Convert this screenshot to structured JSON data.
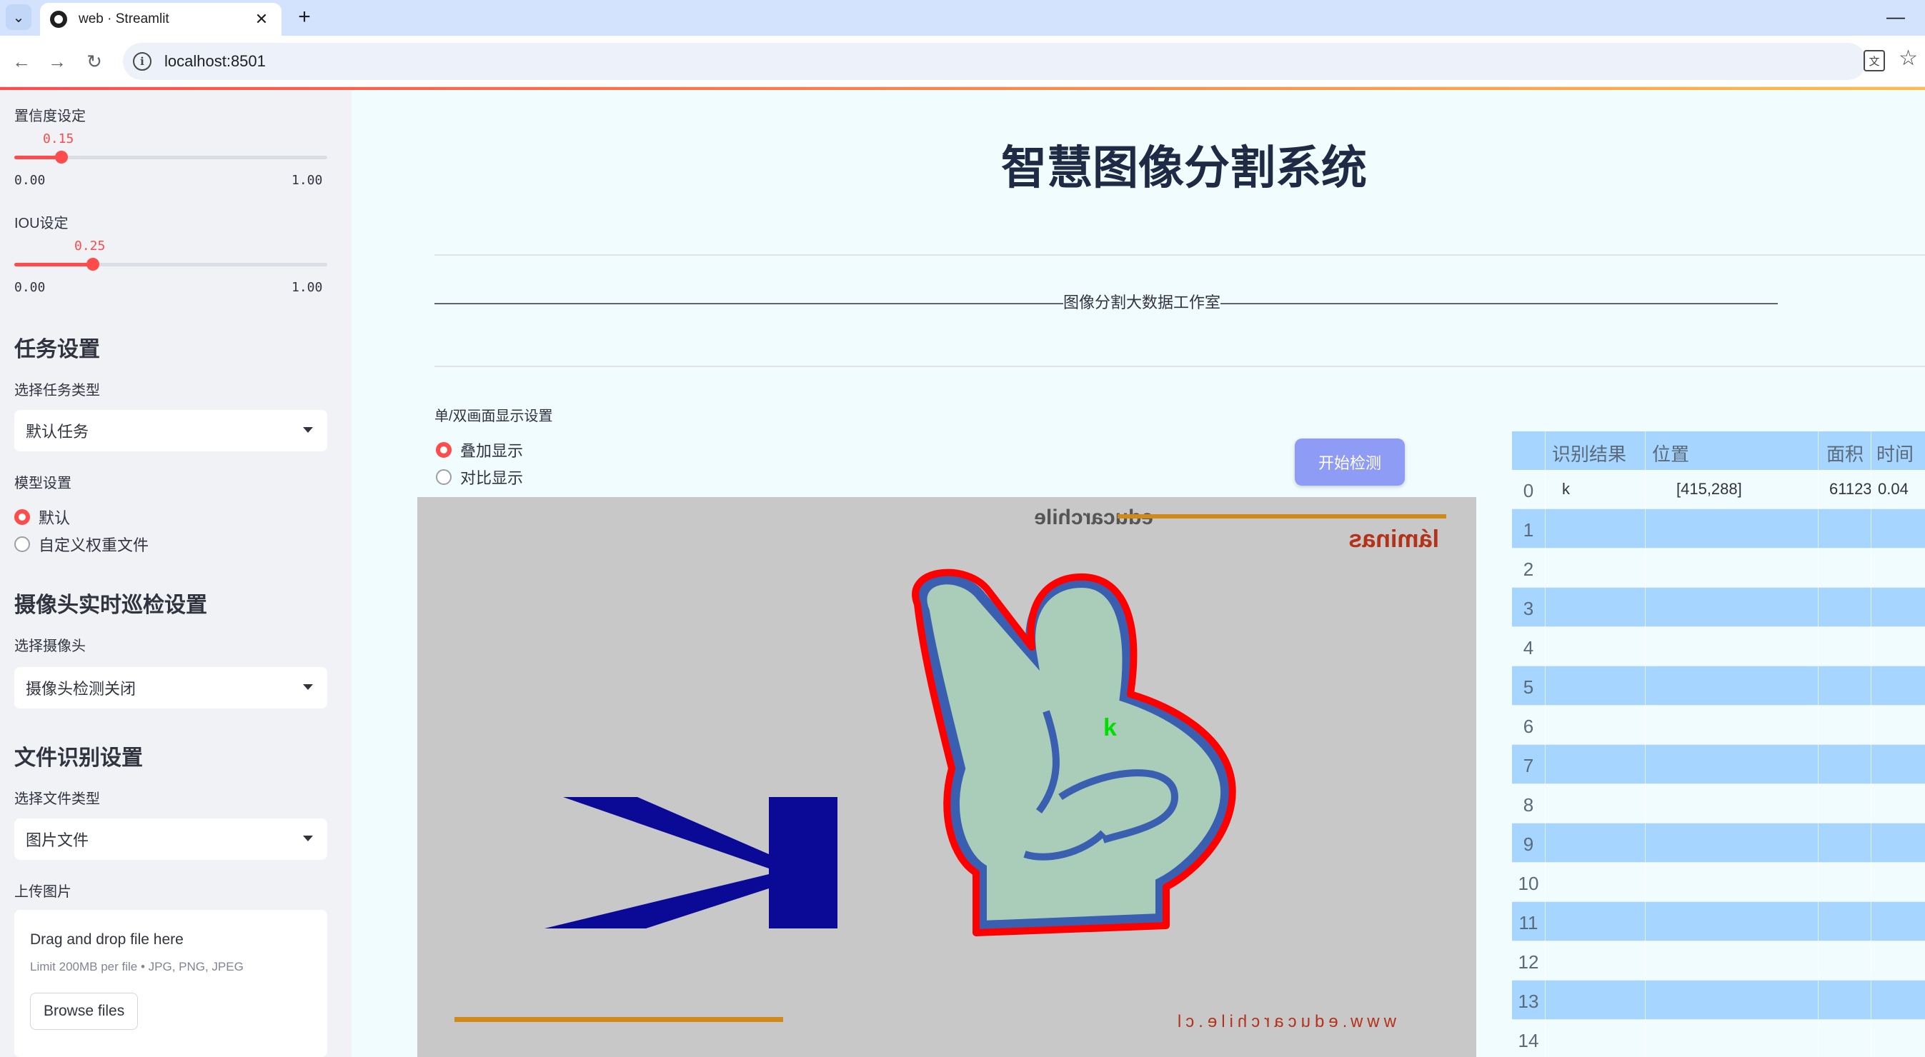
{
  "browser": {
    "tab_title": "web · Streamlit",
    "url": "localhost:8501"
  },
  "sidebar": {
    "confidence": {
      "label": "置信度设定",
      "value": "0.15",
      "value_fraction": 0.15,
      "min": "0.00",
      "max": "1.00"
    },
    "iou": {
      "label": "IOU设定",
      "value": "0.25",
      "value_fraction": 0.25,
      "min": "0.00",
      "max": "1.00"
    },
    "task_heading": "任务设置",
    "task_type_label": "选择任务类型",
    "task_type_value": "默认任务",
    "model_label": "模型设置",
    "model_options": [
      "默认",
      "自定义权重文件"
    ],
    "model_selected": 0,
    "camera_heading": "摄像头实时巡检设置",
    "camera_label": "选择摄像头",
    "camera_value": "摄像头检测关闭",
    "file_heading": "文件识别设置",
    "file_type_label": "选择文件类型",
    "file_type_value": "图片文件",
    "upload_label": "上传图片",
    "upload_title": "Drag and drop file here",
    "upload_limit": "Limit 200MB per file • JPG, PNG, JPEG",
    "browse_label": "Browse files"
  },
  "main": {
    "title": "智慧图像分割系统",
    "banner": "————————————————————————————————————————图像分割大数据工作室————————————————————————————————————————————",
    "display_mode_label": "单/双画面显示设置",
    "display_options": [
      "叠加显示",
      "对比显示"
    ],
    "display_selected": 0,
    "start_button": "开始检测",
    "image": {
      "top_left_logo": "educarchile",
      "top_right_text": "láminas",
      "bottom_right_text": "www.educarchile.cl",
      "letter": "K",
      "detection_label": "k"
    },
    "table": {
      "columns": [
        "",
        "识别结果",
        "位置",
        "面积",
        "时间"
      ],
      "rows": [
        [
          "0",
          "k",
          "[415,288]",
          "61123",
          "0.04"
        ],
        [
          "1",
          "",
          "",
          "",
          ""
        ],
        [
          "2",
          "",
          "",
          "",
          ""
        ],
        [
          "3",
          "",
          "",
          "",
          ""
        ],
        [
          "4",
          "",
          "",
          "",
          ""
        ],
        [
          "5",
          "",
          "",
          "",
          ""
        ],
        [
          "6",
          "",
          "",
          "",
          ""
        ],
        [
          "7",
          "",
          "",
          "",
          ""
        ],
        [
          "8",
          "",
          "",
          "",
          ""
        ],
        [
          "9",
          "",
          "",
          "",
          ""
        ],
        [
          "10",
          "",
          "",
          "",
          ""
        ],
        [
          "11",
          "",
          "",
          "",
          ""
        ],
        [
          "12",
          "",
          "",
          "",
          ""
        ],
        [
          "13",
          "",
          "",
          "",
          ""
        ],
        [
          "14",
          "",
          "",
          "",
          ""
        ]
      ]
    }
  },
  "colors": {
    "accent": "#ff4b4b",
    "button": "#8f9cf6",
    "table_header": "#a6d6ff",
    "sidebar_bg": "#f0f2f6",
    "main_bg": "#f1fcff",
    "mask_outline": "#ff0000",
    "hand_fill": "#a9cdb9",
    "hand_edge": "#3a5fb0",
    "letter_color": "#0a0a96"
  }
}
